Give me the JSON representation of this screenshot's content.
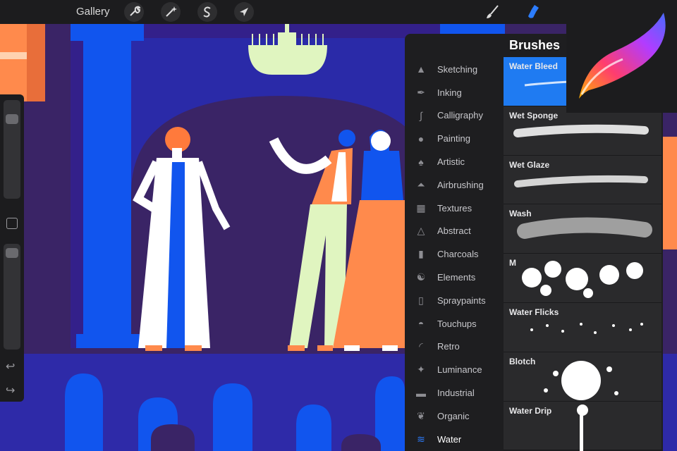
{
  "topbar": {
    "gallery_label": "Gallery",
    "tools_left": [
      "wrench-icon",
      "magic-wand-icon",
      "selection-s-icon",
      "arrow-cursor-icon"
    ],
    "tools_right": [
      "brush-icon",
      "smudge-icon"
    ],
    "accent": "#2c7dff"
  },
  "brushes": {
    "title": "Brushes",
    "categories": [
      {
        "label": "Sketching",
        "icon": "pencil-tip-icon"
      },
      {
        "label": "Inking",
        "icon": "pen-nib-icon"
      },
      {
        "label": "Calligraphy",
        "icon": "calligraphy-icon"
      },
      {
        "label": "Painting",
        "icon": "drop-icon"
      },
      {
        "label": "Artistic",
        "icon": "flame-icon"
      },
      {
        "label": "Airbrushing",
        "icon": "airbrush-icon"
      },
      {
        "label": "Textures",
        "icon": "checker-icon"
      },
      {
        "label": "Abstract",
        "icon": "triangle-icon"
      },
      {
        "label": "Charcoals",
        "icon": "charcoal-icon"
      },
      {
        "label": "Elements",
        "icon": "yin-yang-icon"
      },
      {
        "label": "Spraypaints",
        "icon": "spray-can-icon"
      },
      {
        "label": "Touchups",
        "icon": "touchup-icon"
      },
      {
        "label": "Retro",
        "icon": "retro-icon"
      },
      {
        "label": "Luminance",
        "icon": "sparkle-icon"
      },
      {
        "label": "Industrial",
        "icon": "anvil-icon"
      },
      {
        "label": "Organic",
        "icon": "leaf-icon"
      },
      {
        "label": "Water",
        "icon": "waves-icon"
      }
    ],
    "active_category": "Water",
    "items": [
      {
        "name": "Water Bleed",
        "selected": true
      },
      {
        "name": "Wet Sponge",
        "selected": false
      },
      {
        "name": "Wet Glaze",
        "selected": false
      },
      {
        "name": "Wash",
        "selected": false
      },
      {
        "name": "M",
        "selected": false
      },
      {
        "name": "Water Flicks",
        "selected": false
      },
      {
        "name": "Blotch",
        "selected": false
      },
      {
        "name": "Water Drip",
        "selected": false
      }
    ]
  },
  "sidebar": {
    "size_level": 0.92,
    "opacity_level": 0.95,
    "undo_icon": "undo-icon",
    "redo_icon": "redo-icon"
  },
  "colors": {
    "background": "#3a2466",
    "stage_blue": "#2e2aa8",
    "pillar_blue": "#1155ee",
    "orange": "#ff8a4c",
    "cream": "#e0f5c0"
  }
}
